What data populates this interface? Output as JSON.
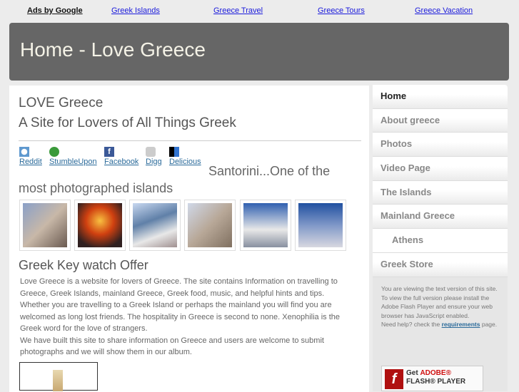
{
  "ads": {
    "label": "Ads by Google",
    "links": [
      "Greek Islands",
      "Greece Travel",
      "Greece Tours",
      "Greece Vacation"
    ]
  },
  "header": {
    "title": "Home - Love Greece"
  },
  "main": {
    "title": "LOVE Greece",
    "subtitle": "A Site for Lovers of All Things Greek",
    "share": [
      "Reddit",
      "StumbleUpon",
      "Facebook",
      "Digg",
      "Delicious"
    ],
    "santorini": "Santorini...One of the most photographed islands",
    "offer_heading": "Greek Key watch Offer",
    "para1": "Love Greece is a website for lovers of Greece. The site contains Information on travelling to Greece, Greek Islands, mainland Greece, Greek food, music, and helpful hints and tips. Whether you are travelling to a Greek Island or perhaps the mainland you will find you are welcomed as long lost friends. The hospitality in Greece is second to none. Xenophilia is the Greek word for the love of strangers.",
    "para2": "We have built this site to share information on Greece and users are welcome to submit photographs and we will show them in our album."
  },
  "nav": [
    "Home",
    "About greece",
    "Photos",
    "Video Page",
    "The Islands",
    "Mainland Greece",
    "Athens",
    "Greek Store"
  ],
  "sidebar": {
    "line1": "You are viewing the text version of this site.",
    "line2": "To view the full version please install the Adobe Flash Player and ensure your web browser has JavaScript enabled.",
    "help_pre": "Need help? check the",
    "help_link": "requirements",
    "help_post": "page.",
    "flash_get": "Get",
    "flash_adobe": "ADOBE®",
    "flash_player": "FLASH® PLAYER"
  }
}
